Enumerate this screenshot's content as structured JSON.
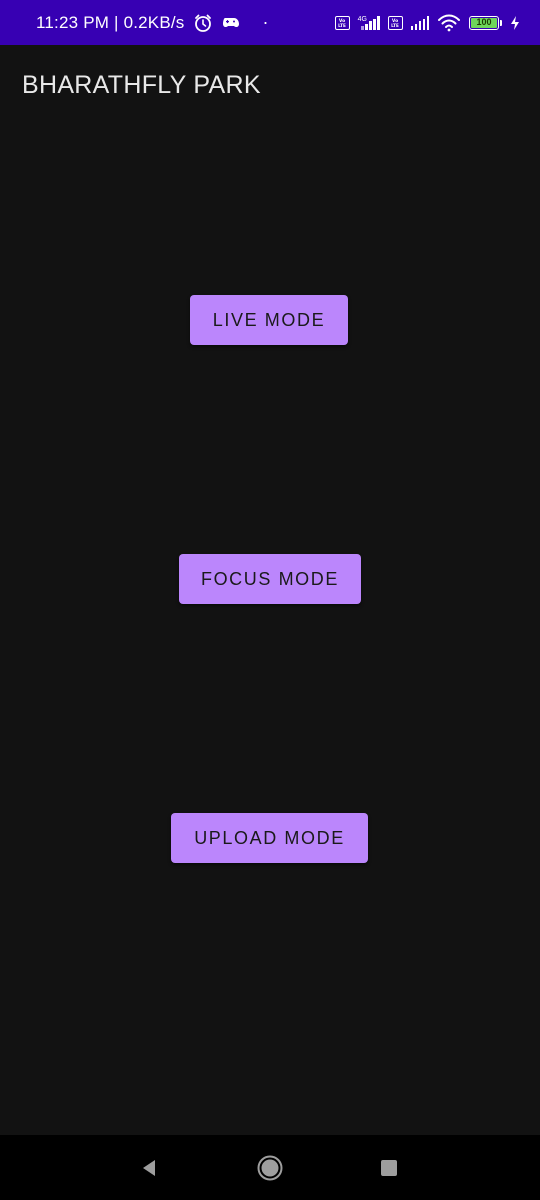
{
  "status_bar": {
    "time_speed": "11:23 PM | 0.2KB/s",
    "dot": "·",
    "volte_label": "Vo\nLTE",
    "net_type": "4G",
    "battery_level": "100",
    "battery_color": "#6fd65a",
    "background_color": "#3700b3",
    "icons": [
      "alarm-icon",
      "game-controller-icon",
      "volte-icon",
      "signal-icon",
      "volte-icon",
      "signal-icon",
      "wifi-icon",
      "battery-icon",
      "charging-icon"
    ]
  },
  "app_bar": {
    "title": "BHARATHFLY PARK"
  },
  "buttons": {
    "live": "LIVE MODE",
    "focus": "FOCUS MODE",
    "upload": "UPLOAD MODE",
    "accent_color": "#bb86fc"
  },
  "nav_bar": {
    "icons": [
      "back-icon",
      "home-icon",
      "recents-icon"
    ]
  }
}
